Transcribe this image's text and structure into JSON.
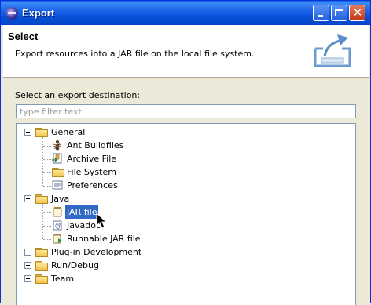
{
  "window": {
    "title": "Export"
  },
  "header": {
    "title": "Select",
    "description": "Export resources into a JAR file on the local file system."
  },
  "destination": {
    "label": "Select an export destination:",
    "filter_placeholder": "type filter text"
  },
  "tree": {
    "general": {
      "label": "General",
      "children": [
        "Ant Buildfiles",
        "Archive File",
        "File System",
        "Preferences"
      ]
    },
    "java": {
      "label": "Java",
      "children": [
        "JAR file",
        "Javadoc",
        "Runnable JAR file"
      ],
      "selected": "JAR file"
    },
    "plugin": {
      "label": "Plug-in Development"
    },
    "rundebug": {
      "label": "Run/Debug"
    },
    "team": {
      "label": "Team"
    }
  },
  "colors": {
    "selection": "#316ac5",
    "titlebar": "#0a5fe6"
  }
}
